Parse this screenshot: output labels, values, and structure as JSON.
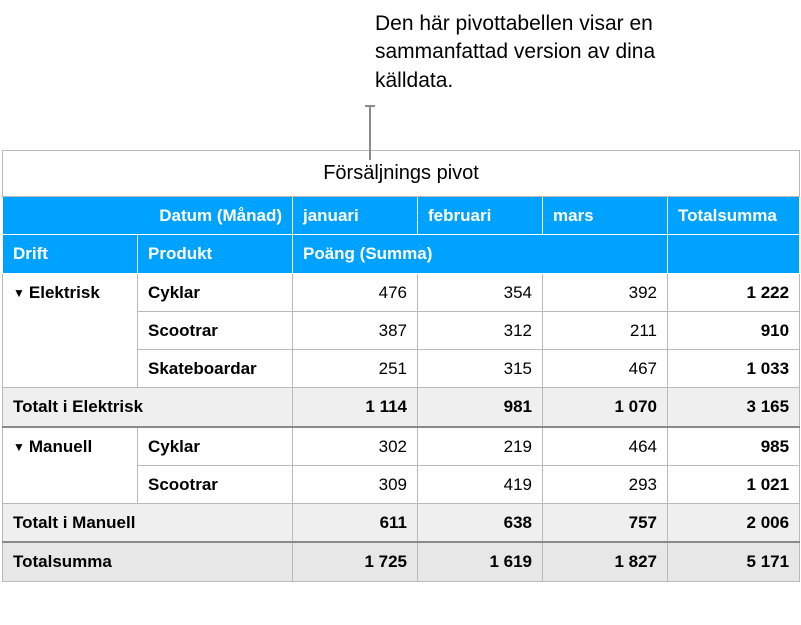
{
  "callout": "Den här pivottabellen visar en sammanfattad version av dina källdata.",
  "table": {
    "title": "Försäljnings pivot",
    "header": {
      "date_group": "Datum (Månad)",
      "months": [
        "januari",
        "februari",
        "mars"
      ],
      "total": "Totalsumma",
      "drift": "Drift",
      "product": "Produkt",
      "measure": "Poäng (Summa)"
    },
    "groups": [
      {
        "name": "Elektrisk",
        "rows": [
          {
            "product": "Cyklar",
            "values": [
              "476",
              "354",
              "392"
            ],
            "total": "1 222"
          },
          {
            "product": "Scootrar",
            "values": [
              "387",
              "312",
              "211"
            ],
            "total": "910"
          },
          {
            "product": "Skateboardar",
            "values": [
              "251",
              "315",
              "467"
            ],
            "total": "1 033"
          }
        ],
        "subtotal_label": "Totalt i Elektrisk",
        "subtotal": {
          "values": [
            "1 114",
            "981",
            "1 070"
          ],
          "total": "3 165"
        }
      },
      {
        "name": "Manuell",
        "rows": [
          {
            "product": "Cyklar",
            "values": [
              "302",
              "219",
              "464"
            ],
            "total": "985"
          },
          {
            "product": "Scootrar",
            "values": [
              "309",
              "419",
              "293"
            ],
            "total": "1 021"
          }
        ],
        "subtotal_label": "Totalt i Manuell",
        "subtotal": {
          "values": [
            "611",
            "638",
            "757"
          ],
          "total": "2 006"
        }
      }
    ],
    "grand_label": "Totalsumma",
    "grand": {
      "values": [
        "1 725",
        "1 619",
        "1 827"
      ],
      "total": "5 171"
    }
  },
  "chart_data": {
    "type": "table",
    "row_dimensions": [
      "Drift",
      "Produkt"
    ],
    "column_dimension": "Datum (Månad)",
    "columns": [
      "januari",
      "februari",
      "mars"
    ],
    "measure": "Poäng (Summa)",
    "rows": [
      {
        "Drift": "Elektrisk",
        "Produkt": "Cyklar",
        "januari": 476,
        "februari": 354,
        "mars": 392,
        "Totalsumma": 1222
      },
      {
        "Drift": "Elektrisk",
        "Produkt": "Scootrar",
        "januari": 387,
        "februari": 312,
        "mars": 211,
        "Totalsumma": 910
      },
      {
        "Drift": "Elektrisk",
        "Produkt": "Skateboardar",
        "januari": 251,
        "februari": 315,
        "mars": 467,
        "Totalsumma": 1033
      },
      {
        "Drift": "Manuell",
        "Produkt": "Cyklar",
        "januari": 302,
        "februari": 219,
        "mars": 464,
        "Totalsumma": 985
      },
      {
        "Drift": "Manuell",
        "Produkt": "Scootrar",
        "januari": 309,
        "februari": 419,
        "mars": 293,
        "Totalsumma": 1021
      }
    ],
    "subtotals": [
      {
        "Drift": "Elektrisk",
        "januari": 1114,
        "februari": 981,
        "mars": 1070,
        "Totalsumma": 3165
      },
      {
        "Drift": "Manuell",
        "januari": 611,
        "februari": 638,
        "mars": 757,
        "Totalsumma": 2006
      }
    ],
    "grand_total": {
      "januari": 1725,
      "februari": 1619,
      "mars": 1827,
      "Totalsumma": 5171
    }
  }
}
